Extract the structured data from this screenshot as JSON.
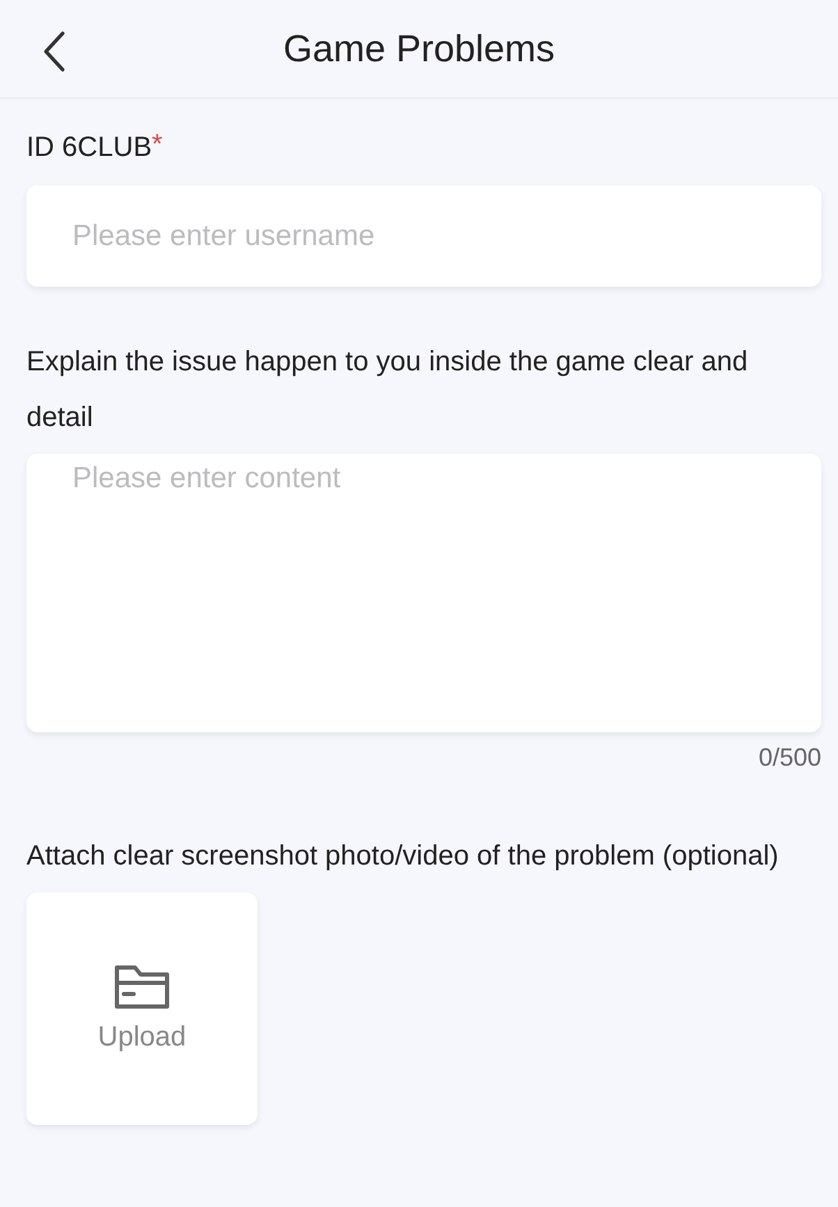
{
  "header": {
    "title": "Game Problems"
  },
  "id_field": {
    "label": "ID 6CLUB",
    "required_mark": "*",
    "placeholder": "Please enter username"
  },
  "content_field": {
    "label": "Explain the issue happen to you inside the game clear and detail",
    "placeholder": "Please enter content",
    "counter": "0/500"
  },
  "attachment": {
    "label": "Attach clear screenshot photo/video of the problem (optional)",
    "upload_label": "Upload"
  }
}
